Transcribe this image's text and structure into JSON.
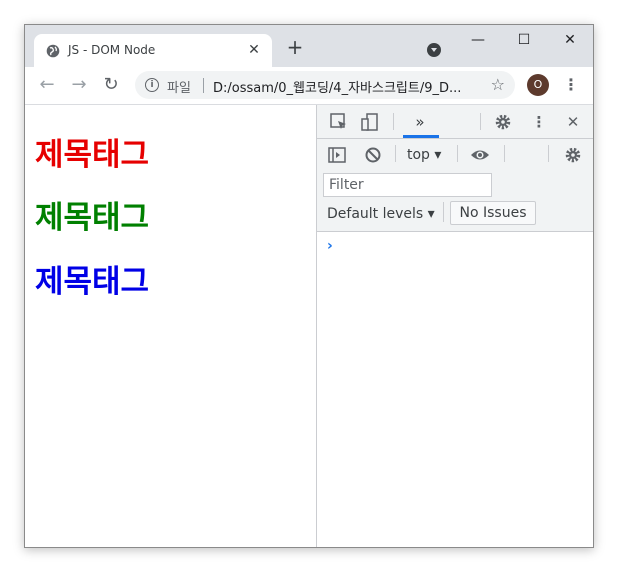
{
  "browser": {
    "tab": {
      "title": "JS - DOM Node",
      "close": "✕"
    },
    "new_tab": "+",
    "window_controls": {
      "minimize": "—",
      "maximize": "☐",
      "close": "✕"
    },
    "nav": {
      "back": "←",
      "forward": "→",
      "reload": "↻"
    },
    "omnibox": {
      "info": "i",
      "scheme_label": "파일",
      "url": "D:/ossam/0_웹코딩/4_자바스크립트/9_D...",
      "star": "☆"
    },
    "profile_initial": "O",
    "menu": "⋮"
  },
  "page": {
    "headings": [
      {
        "text": "제목태그",
        "color": "#e60000"
      },
      {
        "text": "제목태그",
        "color": "#008000"
      },
      {
        "text": "제목태그",
        "color": "#0000e6"
      }
    ]
  },
  "devtools": {
    "more_tabs": "»",
    "context": "top ▾",
    "filter_placeholder": "Filter",
    "levels": "Default levels ▾",
    "issues": "No Issues",
    "prompt": "›",
    "colors": {
      "accent": "#1a73e8",
      "panel_bg": "#f1f3f4"
    }
  }
}
